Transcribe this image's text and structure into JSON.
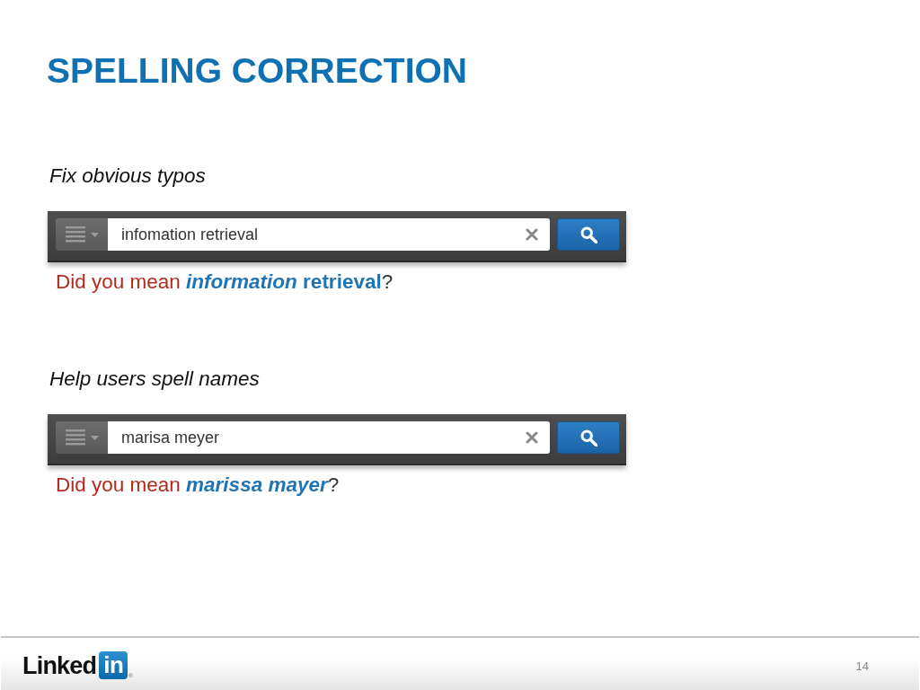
{
  "slide": {
    "title": "SPELLING CORRECTION"
  },
  "examples": [
    {
      "caption": "Fix obvious typos",
      "search": {
        "value": "infomation retrieval"
      },
      "suggestion": {
        "prompt": "Did you mean",
        "words": [
          {
            "text": "information",
            "corrected": true
          },
          {
            "text": "retrieval",
            "corrected": false
          }
        ],
        "end": "?"
      }
    },
    {
      "caption": "Help users spell names",
      "search": {
        "value": "marisa meyer"
      },
      "suggestion": {
        "prompt": "Did you mean",
        "words": [
          {
            "text": "marissa",
            "corrected": true
          },
          {
            "text": "mayer",
            "corrected": true
          }
        ],
        "end": "?"
      }
    }
  ],
  "footer": {
    "logo": {
      "text": "Linked",
      "badge": "in",
      "mark": "®"
    },
    "page_number": "14"
  }
}
